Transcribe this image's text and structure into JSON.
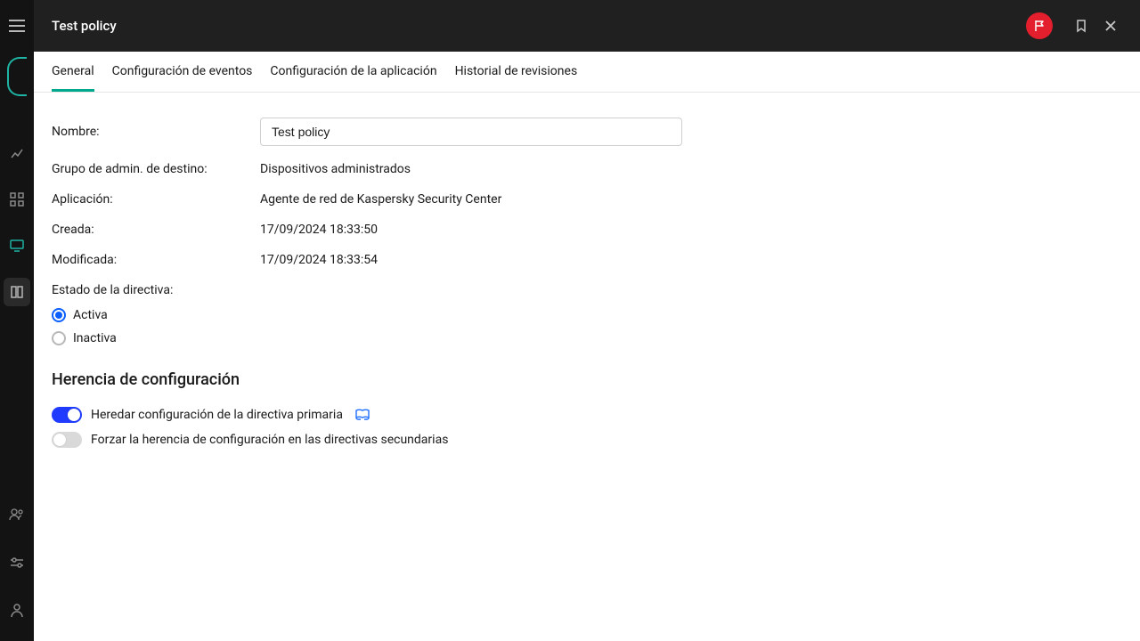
{
  "header": {
    "title": "Test policy"
  },
  "tabs": [
    {
      "label": "General",
      "active": true
    },
    {
      "label": "Configuración de eventos",
      "active": false
    },
    {
      "label": "Configuración de la aplicación",
      "active": false
    },
    {
      "label": "Historial de revisiones",
      "active": false
    }
  ],
  "form": {
    "name_label": "Nombre:",
    "name_value": "Test policy",
    "group_label": "Grupo de admin. de destino:",
    "group_value": "Dispositivos administrados",
    "app_label": "Aplicación:",
    "app_value": "Agente de red de Kaspersky Security Center",
    "created_label": "Creada:",
    "created_value": "17/09/2024 18:33:50",
    "modified_label": "Modificada:",
    "modified_value": "17/09/2024 18:33:54",
    "status_label": "Estado de la directiva:",
    "status_active_label": "Activa",
    "status_inactive_label": "Inactiva"
  },
  "inheritance": {
    "section_title": "Herencia de configuración",
    "inherit_label": "Heredar configuración de la directiva primaria",
    "force_label": "Forzar la herencia de configuración en las directivas secundarias"
  }
}
